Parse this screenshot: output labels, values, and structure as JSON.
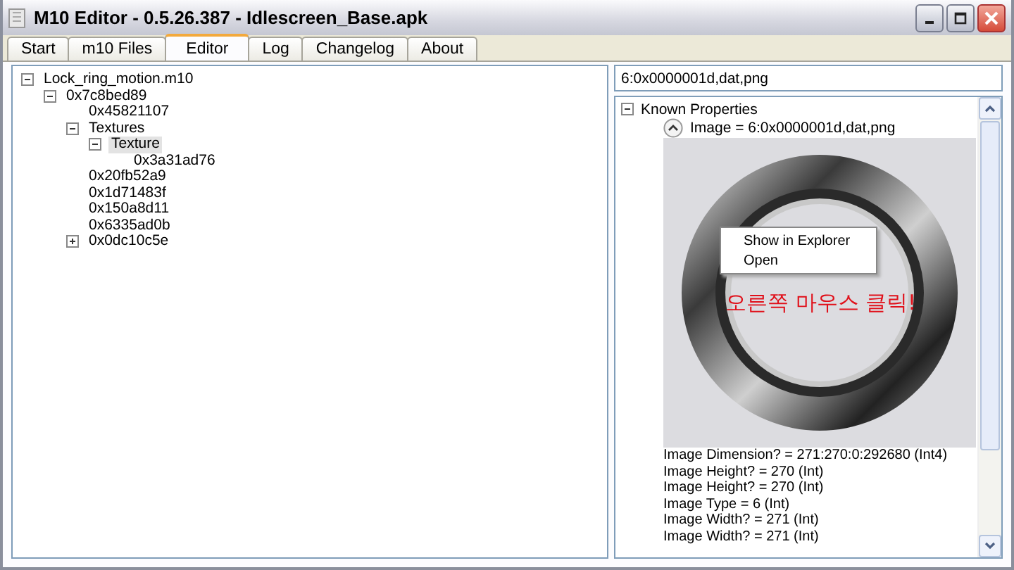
{
  "window": {
    "title": "M10 Editor - 0.5.26.387 - Idlescreen_Base.apk"
  },
  "tabs": [
    {
      "label": "Start",
      "selected": false
    },
    {
      "label": "m10 Files",
      "selected": false
    },
    {
      "label": "Editor",
      "selected": true
    },
    {
      "label": "Log",
      "selected": false
    },
    {
      "label": "Changelog",
      "selected": false
    },
    {
      "label": "About",
      "selected": false
    }
  ],
  "tree": [
    {
      "label": "Lock_ring_motion.m10",
      "expanded": true,
      "selected": false,
      "children": [
        {
          "label": "0x7c8bed89",
          "expanded": true,
          "selected": false,
          "children": [
            {
              "label": "0x45821107",
              "selected": false
            },
            {
              "label": "Textures",
              "expanded": true,
              "selected": false,
              "children": [
                {
                  "label": "Texture",
                  "expanded": true,
                  "selected": true,
                  "children": [
                    {
                      "label": "0x3a31ad76",
                      "selected": false
                    }
                  ]
                }
              ]
            },
            {
              "label": "0x20fb52a9",
              "selected": false
            },
            {
              "label": "0x1d71483f",
              "selected": false
            },
            {
              "label": "0x150a8d11",
              "selected": false
            },
            {
              "label": "0x6335ad0b",
              "selected": false
            },
            {
              "label": "0x0dc10c5e",
              "expanded": false,
              "selected": false
            }
          ]
        }
      ]
    }
  ],
  "path_field": {
    "value": "6:0x0000001d,dat,png"
  },
  "properties": {
    "group": "Known Properties",
    "expanded": true,
    "image_label": "Image = 6:0x0000001d,dat,png",
    "context_menu": [
      "Show in Explorer",
      "Open"
    ],
    "annotation": "오른쪽 마우스 클릭!",
    "rows": [
      "Image Dimension? = 271:270:0:292680 (Int4)",
      "Image Height? = 270 (Int)",
      "Image Height? = 270 (Int)",
      "Image Type = 6 (Int)",
      "Image Width? = 271 (Int)",
      "Image Width? = 271 (Int)"
    ]
  }
}
